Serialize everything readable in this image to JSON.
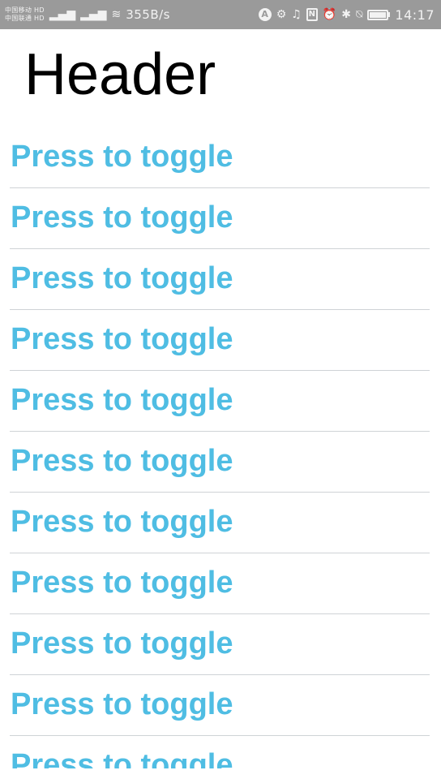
{
  "status_bar": {
    "carrier_line1": "中国移动 HD",
    "carrier_line2": "中国联通 HD",
    "network_speed": "355B/s",
    "time": "14:17",
    "icons": [
      "signal-icon",
      "signal-icon",
      "wifi-icon",
      "app-a-icon",
      "app-gear-icon",
      "headphones-icon",
      "nfc-icon",
      "alarm-icon",
      "bluetooth-icon",
      "mute-icon",
      "battery-icon"
    ]
  },
  "header": {
    "title": "Header"
  },
  "list": {
    "items": [
      {
        "label": "Press to toggle"
      },
      {
        "label": "Press to toggle"
      },
      {
        "label": "Press to toggle"
      },
      {
        "label": "Press to toggle"
      },
      {
        "label": "Press to toggle"
      },
      {
        "label": "Press to toggle"
      },
      {
        "label": "Press to toggle"
      },
      {
        "label": "Press to toggle"
      },
      {
        "label": "Press to toggle"
      },
      {
        "label": "Press to toggle"
      },
      {
        "label": "Press to toggle"
      }
    ]
  },
  "colors": {
    "status_bar_bg": "#9a9a9a",
    "item_text": "#4fbde3",
    "divider": "#cfd3d6",
    "background": "#ffffff"
  }
}
